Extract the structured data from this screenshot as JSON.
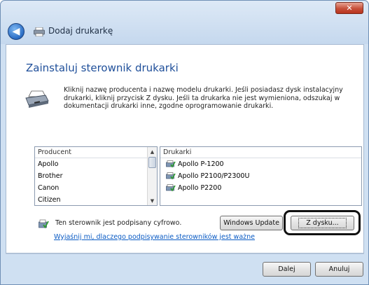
{
  "window": {
    "title": "Dodaj drukarkę",
    "close_label": "✕",
    "back_glyph": "◀"
  },
  "page": {
    "heading": "Zainstaluj sterownik drukarki",
    "instructions": "Kliknij nazwę producenta i nazwę modelu drukarki. Jeśli posiadasz dysk instalacyjny drukarki, kliknij przycisk Z dysku. Jeśli ta drukarka nie jest wymieniona, odszukaj w dokumentacji drukarki inne, zgodne oprogramowanie drukarki."
  },
  "manufacturers": {
    "header": "Producent",
    "items": [
      "Apollo",
      "Brother",
      "Canon",
      "Citizen"
    ],
    "selected": "Apollo"
  },
  "printers": {
    "header": "Drukarki",
    "items": [
      "Apollo P-1200",
      "Apollo P2100/P2300U",
      "Apollo P2200"
    ]
  },
  "driver_status": {
    "text": "Ten sterownik jest podpisany cyfrowo.",
    "link": "Wyjaśnij mi, dlaczego podpisywanie sterowników jest ważne"
  },
  "buttons": {
    "windows_update": "Windows Update",
    "have_disk": "Z dysku...",
    "next": "Dalej",
    "cancel": "Anuluj"
  },
  "icons": {
    "back": "back-arrow-icon",
    "title_printer": "printer-icon",
    "info_printer": "printer-icon",
    "printer_item": "printer-driver-icon",
    "signed": "signed-driver-icon"
  },
  "colors": {
    "heading": "#1f4f9a",
    "link": "#0a5bc4",
    "frame": "#cfe0f2",
    "close": "#c7503a"
  }
}
